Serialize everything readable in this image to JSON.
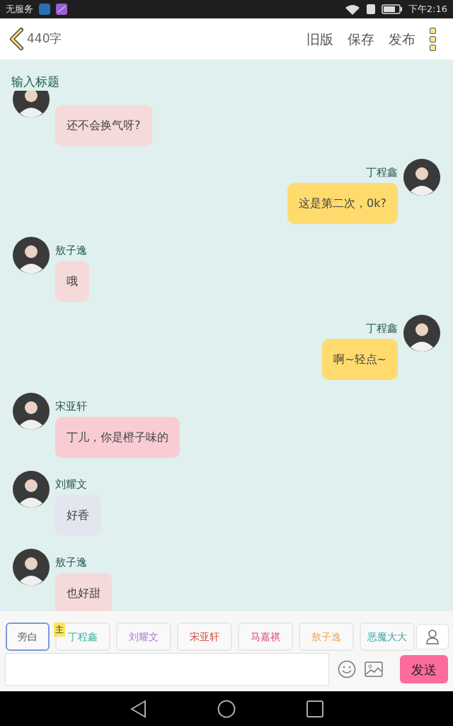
{
  "status_bar": {
    "carrier": "无服务",
    "time": "下午2:16"
  },
  "header": {
    "word_count": "440字",
    "actions": [
      "旧版",
      "保存",
      "发布"
    ]
  },
  "title_field": {
    "placeholder": "输入标题"
  },
  "messages": [
    {
      "outgoing": false,
      "text": "还不会换气呀?",
      "color": "#f6dada"
    },
    {
      "outgoing": true,
      "name": "丁程鑫",
      "text": "这是第二次，0k?",
      "color": "#ffdb6e"
    },
    {
      "outgoing": false,
      "name": "敖子逸",
      "text": "哦",
      "color": "#f6dada"
    },
    {
      "outgoing": true,
      "name": "丁程鑫",
      "text": "啊~轻点~",
      "color": "#ffdb6e"
    },
    {
      "outgoing": false,
      "name": "宋亚轩",
      "text": "丁儿，你是橙子味的",
      "color": "#f9ccd4"
    },
    {
      "outgoing": false,
      "name": "刘耀文",
      "text": "好香",
      "color": "#e3e6ee"
    },
    {
      "outgoing": false,
      "name": "敖子逸",
      "text": "也好甜",
      "color": "#f6dada"
    }
  ],
  "characters": [
    {
      "label": "旁白",
      "color": "#555555",
      "selected": true
    },
    {
      "label": "丁程鑫",
      "color": "#3bb49a",
      "selected": false,
      "badge": "主"
    },
    {
      "label": "刘耀文",
      "color": "#b07ad6",
      "selected": false
    },
    {
      "label": "宋亚轩",
      "color": "#d0463a",
      "selected": false
    },
    {
      "label": "马嘉祺",
      "color": "#e0457c",
      "selected": false
    },
    {
      "label": "敖子逸",
      "color": "#f0a860",
      "selected": false
    },
    {
      "label": "恶魔大大",
      "color": "#3aa6a6",
      "selected": false
    }
  ],
  "composer": {
    "send": "发送"
  }
}
